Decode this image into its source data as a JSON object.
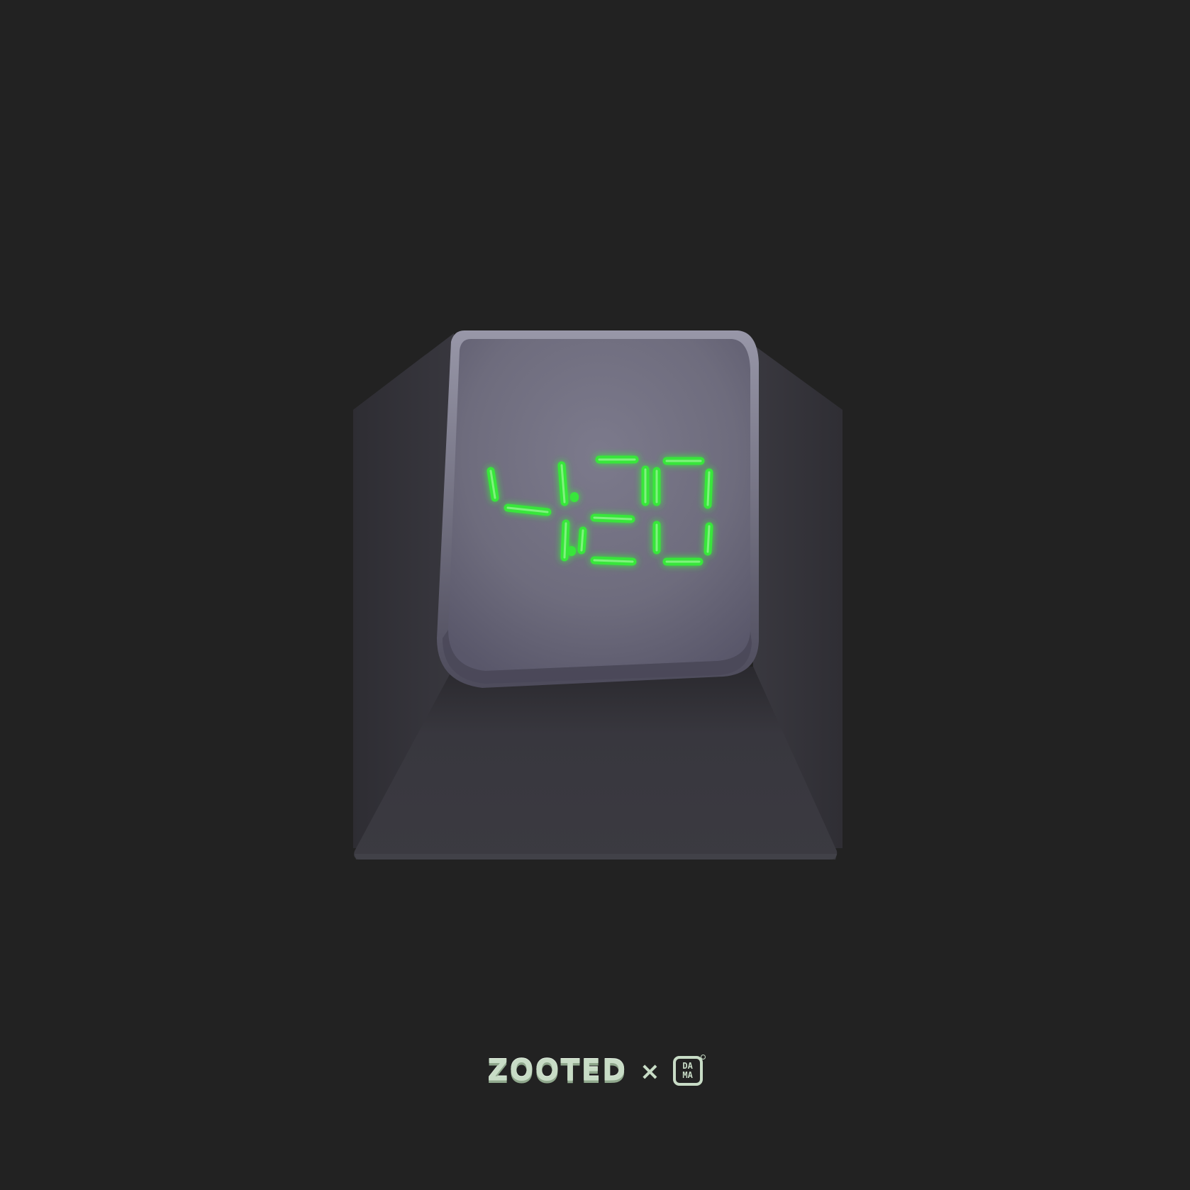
{
  "display": {
    "text": "4:20",
    "color": "#39e63a"
  },
  "keycap": {
    "top_color": "#6f6d7e",
    "body_color": "#3a393f"
  },
  "background_color": "#222222",
  "footer": {
    "brand_left": "ZOOTED",
    "separator": "×",
    "brand_right_letters": [
      "DA",
      "MA"
    ],
    "accent_color": "#c8dcc6"
  }
}
